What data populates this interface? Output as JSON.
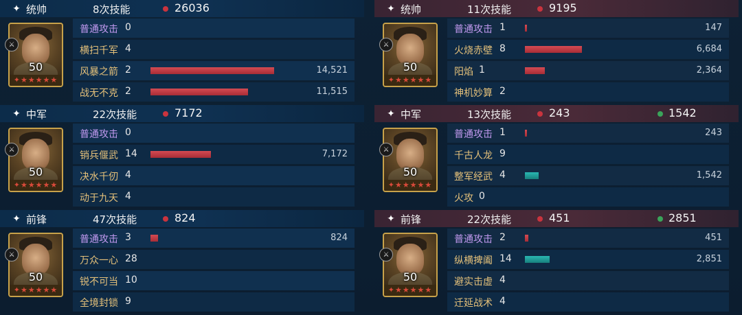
{
  "left": {
    "sections": [
      {
        "role": "统帅",
        "skill_count": "8次技能",
        "damage": "26036",
        "level": "50",
        "stars": "✦★★★★★",
        "skills": [
          {
            "name": "普通攻击",
            "count": "0",
            "value": "",
            "bar_fraction": 0,
            "bar_color": ""
          },
          {
            "name": "横扫千军",
            "count": "4",
            "value": "",
            "bar_fraction": 0,
            "bar_color": ""
          },
          {
            "name": "风暴之箭",
            "count": "2",
            "value": "14,521",
            "bar_fraction": 1.0,
            "bar_color": "red"
          },
          {
            "name": "战无不克",
            "count": "2",
            "value": "11,515",
            "bar_fraction": 0.79,
            "bar_color": "red"
          }
        ]
      },
      {
        "role": "中军",
        "skill_count": "22次技能",
        "damage": "7172",
        "level": "50",
        "stars": "✦★★★★★",
        "skills": [
          {
            "name": "普通攻击",
            "count": "0",
            "value": "",
            "bar_fraction": 0,
            "bar_color": ""
          },
          {
            "name": "销兵偃武",
            "count": "14",
            "value": "7,172",
            "bar_fraction": 0.49,
            "bar_color": "red"
          },
          {
            "name": "决水千仞",
            "count": "4",
            "value": "",
            "bar_fraction": 0,
            "bar_color": ""
          },
          {
            "name": "动于九天",
            "count": "4",
            "value": "",
            "bar_fraction": 0,
            "bar_color": ""
          }
        ]
      },
      {
        "role": "前锋",
        "skill_count": "47次技能",
        "damage": "824",
        "level": "50",
        "stars": "✦★★★★★",
        "skills": [
          {
            "name": "普通攻击",
            "count": "3",
            "value": "824",
            "bar_fraction": 0.06,
            "bar_color": "red"
          },
          {
            "name": "万众一心",
            "count": "28",
            "value": "",
            "bar_fraction": 0,
            "bar_color": ""
          },
          {
            "name": "锐不可当",
            "count": "10",
            "value": "",
            "bar_fraction": 0,
            "bar_color": ""
          },
          {
            "name": "全境封锁",
            "count": "9",
            "value": "",
            "bar_fraction": 0,
            "bar_color": ""
          }
        ]
      }
    ]
  },
  "right": {
    "sections": [
      {
        "role": "统帅",
        "skill_count": "11次技能",
        "damage": "9195",
        "heal": "",
        "level": "50",
        "stars": "✦★★★★★",
        "skills": [
          {
            "name": "普通攻击",
            "count": "1",
            "value": "147",
            "bar_fraction": 0.01,
            "bar_color": "red"
          },
          {
            "name": "火烧赤壁",
            "count": "8",
            "value": "6,684",
            "bar_fraction": 0.46,
            "bar_color": "red"
          },
          {
            "name": "阳焰",
            "count": "1",
            "value": "2,364",
            "bar_fraction": 0.16,
            "bar_color": "red"
          },
          {
            "name": "神机妙算",
            "count": "2",
            "value": "",
            "bar_fraction": 0,
            "bar_color": ""
          }
        ]
      },
      {
        "role": "中军",
        "skill_count": "13次技能",
        "damage": "243",
        "heal": "1542",
        "level": "50",
        "stars": "✦★★★★★",
        "skills": [
          {
            "name": "普通攻击",
            "count": "1",
            "value": "243",
            "bar_fraction": 0.01,
            "bar_color": "red"
          },
          {
            "name": "千古人龙",
            "count": "9",
            "value": "",
            "bar_fraction": 0,
            "bar_color": ""
          },
          {
            "name": "整军经武",
            "count": "4",
            "value": "1,542",
            "bar_fraction": 0.11,
            "bar_color": "teal"
          },
          {
            "name": "火攻",
            "count": "0",
            "value": "",
            "bar_fraction": 0,
            "bar_color": ""
          }
        ]
      },
      {
        "role": "前锋",
        "skill_count": "22次技能",
        "damage": "451",
        "heal": "2851",
        "level": "50",
        "stars": "✦★★★★★",
        "skills": [
          {
            "name": "普通攻击",
            "count": "2",
            "value": "451",
            "bar_fraction": 0.03,
            "bar_color": "red"
          },
          {
            "name": "纵横捭阖",
            "count": "14",
            "value": "2,851",
            "bar_fraction": 0.2,
            "bar_color": "teal"
          },
          {
            "name": "避实击虚",
            "count": "4",
            "value": "",
            "bar_fraction": 0,
            "bar_color": ""
          },
          {
            "name": "迁延战术",
            "count": "4",
            "value": "",
            "bar_fraction": 0,
            "bar_color": ""
          }
        ]
      }
    ]
  }
}
